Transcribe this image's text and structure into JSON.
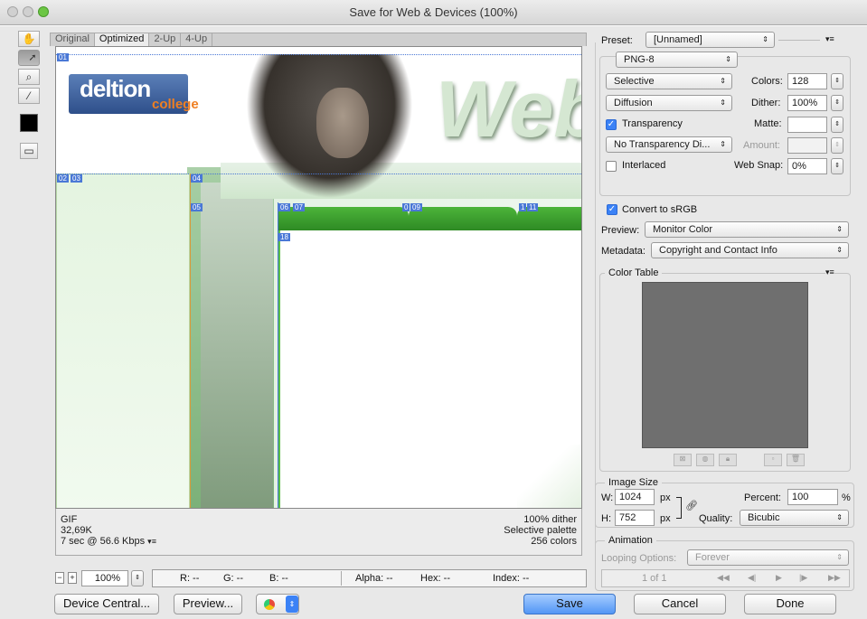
{
  "window": {
    "title": "Save for Web & Devices (100%)"
  },
  "tabs": [
    "Original",
    "Optimized",
    "2-Up",
    "4-Up"
  ],
  "canvas": {
    "logo_line1": "deltion",
    "logo_line2": "college",
    "web_text": "Web",
    "slices": [
      "01",
      "02",
      "03",
      "04",
      "05",
      "06",
      "07",
      "0",
      "09",
      "1",
      "11",
      "18"
    ]
  },
  "status": {
    "format": "GIF",
    "size": "32,69K",
    "time": "7 sec @ 56.6 Kbps",
    "dither": "100% dither",
    "palette": "Selective palette",
    "colors": "256 colors"
  },
  "infobar": {
    "zoom": "100%",
    "r": "R: --",
    "g": "G: --",
    "b": "B: --",
    "alpha": "Alpha: --",
    "hex": "Hex: --",
    "index": "Index: --"
  },
  "buttons": {
    "device_central": "Device Central...",
    "preview": "Preview...",
    "save": "Save",
    "cancel": "Cancel",
    "done": "Done"
  },
  "settings": {
    "preset_label": "Preset:",
    "preset_value": "[Unnamed]",
    "format": "PNG-8",
    "reduction": "Selective",
    "dither_algo": "Diffusion",
    "colors_label": "Colors:",
    "colors_value": "128",
    "dither_label": "Dither:",
    "dither_value": "100%",
    "transparency_label": "Transparency",
    "transparency_checked": true,
    "matte_label": "Matte:",
    "trans_dither": "No Transparency Di...",
    "amount_label": "Amount:",
    "interlaced_label": "Interlaced",
    "interlaced_checked": false,
    "websnap_label": "Web Snap:",
    "websnap_value": "0%",
    "convert_label": "Convert to sRGB",
    "convert_checked": true,
    "preview_label": "Preview:",
    "preview_value": "Monitor Color",
    "metadata_label": "Metadata:",
    "metadata_value": "Copyright and Contact Info"
  },
  "color_table": {
    "title": "Color Table"
  },
  "image_size": {
    "title": "Image Size",
    "w_label": "W:",
    "w_value": "1024",
    "h_label": "H:",
    "h_value": "752",
    "unit": "px",
    "percent_label": "Percent:",
    "percent_value": "100",
    "percent_unit": "%",
    "quality_label": "Quality:",
    "quality_value": "Bicubic"
  },
  "animation": {
    "title": "Animation",
    "looping_label": "Looping Options:",
    "looping_value": "Forever",
    "frame_counter": "1 of 1"
  }
}
